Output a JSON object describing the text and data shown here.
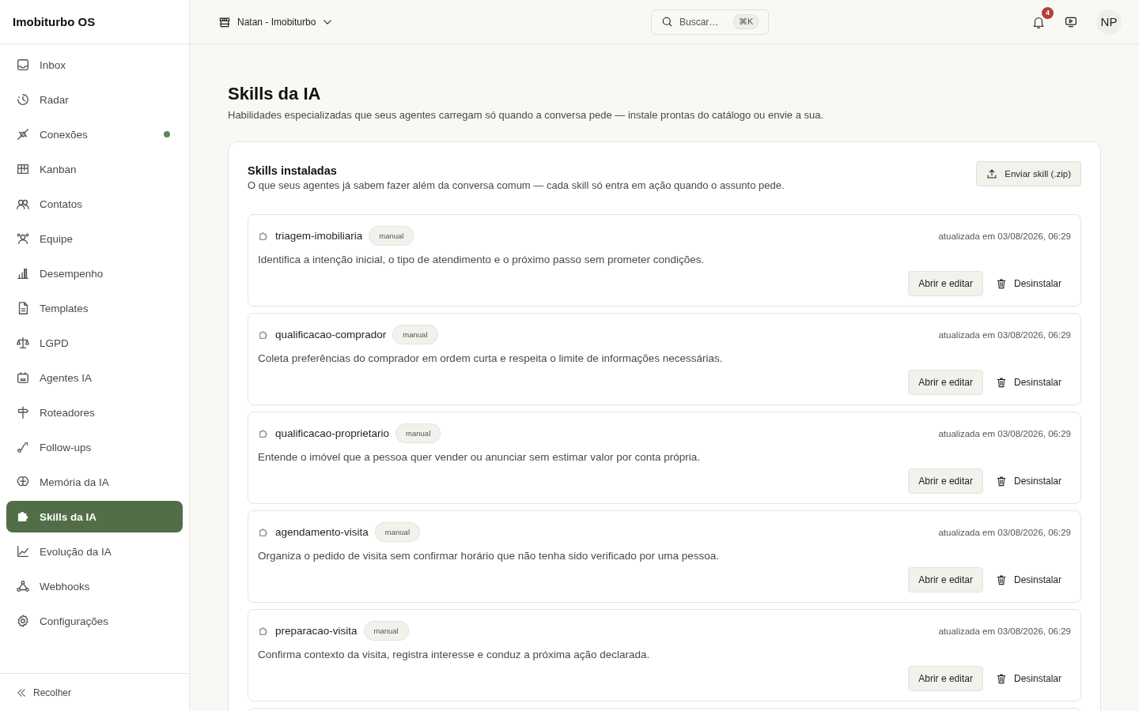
{
  "app": {
    "title": "Imobiturbo OS"
  },
  "sidebar": {
    "items": [
      {
        "label": "Inbox",
        "selected": false,
        "indicator": false
      },
      {
        "label": "Radar",
        "selected": false,
        "indicator": false
      },
      {
        "label": "Conexões",
        "selected": false,
        "indicator": true
      },
      {
        "label": "Kanban",
        "selected": false,
        "indicator": false
      },
      {
        "label": "Contatos",
        "selected": false,
        "indicator": false
      },
      {
        "label": "Equipe",
        "selected": false,
        "indicator": false
      },
      {
        "label": "Desempenho",
        "selected": false,
        "indicator": false
      },
      {
        "label": "Templates",
        "selected": false,
        "indicator": false
      },
      {
        "label": "LGPD",
        "selected": false,
        "indicator": false
      },
      {
        "label": "Agentes IA",
        "selected": false,
        "indicator": false
      },
      {
        "label": "Roteadores",
        "selected": false,
        "indicator": false
      },
      {
        "label": "Follow-ups",
        "selected": false,
        "indicator": false
      },
      {
        "label": "Memória da IA",
        "selected": false,
        "indicator": false
      },
      {
        "label": "Skills da IA",
        "selected": true,
        "indicator": false
      },
      {
        "label": "Evolução da IA",
        "selected": false,
        "indicator": false
      },
      {
        "label": "Webhooks",
        "selected": false,
        "indicator": false
      },
      {
        "label": "Configurações",
        "selected": false,
        "indicator": false
      }
    ],
    "collapse": "Recolher"
  },
  "header": {
    "workspace": "Natan - Imobiturbo",
    "search": {
      "placeholder": "Buscar…",
      "shortcut": "⌘K"
    },
    "notifications": "4",
    "avatar": "NP"
  },
  "page": {
    "title": "Skills da IA",
    "subtitle": "Habilidades especializadas que seus agentes carregam só quando a conversa pede — instale prontas do catálogo ou envie a sua."
  },
  "installed": {
    "title": "Skills instaladas",
    "subtitle": "O que seus agentes já sabem fazer além da conversa comum — cada skill só entra em ação quando o assunto pede.",
    "upload": "Enviar skill (.zip)",
    "skills": [
      {
        "name": "triagem-imobiliaria",
        "tag": "manual",
        "updated": "atualizada em 03/08/2026, 06:29",
        "description": "Identifica a intenção inicial, o tipo de atendimento e o próximo passo sem prometer condições.",
        "open": "Abrir e editar",
        "uninstall": "Desinstalar"
      },
      {
        "name": "qualificacao-comprador",
        "tag": "manual",
        "updated": "atualizada em 03/08/2026, 06:29",
        "description": "Coleta preferências do comprador em ordem curta e respeita o limite de informações necessárias.",
        "open": "Abrir e editar",
        "uninstall": "Desinstalar"
      },
      {
        "name": "qualificacao-proprietario",
        "tag": "manual",
        "updated": "atualizada em 03/08/2026, 06:29",
        "description": "Entende o imóvel que a pessoa quer vender ou anunciar sem estimar valor por conta própria.",
        "open": "Abrir e editar",
        "uninstall": "Desinstalar"
      },
      {
        "name": "agendamento-visita",
        "tag": "manual",
        "updated": "atualizada em 03/08/2026, 06:29",
        "description": "Organiza o pedido de visita sem confirmar horário que não tenha sido verificado por uma pessoa.",
        "open": "Abrir e editar",
        "uninstall": "Desinstalar"
      },
      {
        "name": "preparacao-visita",
        "tag": "manual",
        "updated": "atualizada em 03/08/2026, 06:29",
        "description": "Confirma contexto da visita, registra interesse e conduz a próxima ação declarada.",
        "open": "Abrir e editar",
        "uninstall": "Desinstalar"
      }
    ]
  }
}
